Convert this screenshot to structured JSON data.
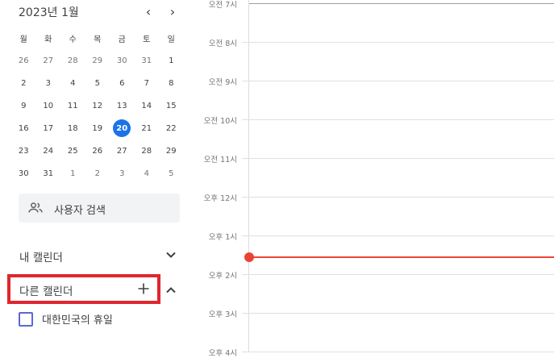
{
  "mini_calendar": {
    "title": "2023년 1월",
    "prev_icon": "‹",
    "next_icon": "›",
    "weekdays": [
      "월",
      "화",
      "수",
      "목",
      "금",
      "토",
      "일"
    ],
    "weeks": [
      [
        "26",
        "27",
        "28",
        "29",
        "30",
        "31",
        "1"
      ],
      [
        "2",
        "3",
        "4",
        "5",
        "6",
        "7",
        "8"
      ],
      [
        "9",
        "10",
        "11",
        "12",
        "13",
        "14",
        "15"
      ],
      [
        "16",
        "17",
        "18",
        "19",
        "20",
        "21",
        "22"
      ],
      [
        "23",
        "24",
        "25",
        "26",
        "27",
        "28",
        "29"
      ],
      [
        "30",
        "31",
        "1",
        "2",
        "3",
        "4",
        "5"
      ]
    ],
    "today": "20"
  },
  "search": {
    "label": "사용자 검색",
    "icon": "people-icon"
  },
  "my_calendars": {
    "title": "내 캘린더"
  },
  "other_calendars": {
    "title": "다른 캘린더",
    "items": [
      {
        "label": "대한민국의 휴일",
        "checked": false
      }
    ]
  },
  "timeline": {
    "hours": [
      "오전 7시",
      "오전 8시",
      "오전 9시",
      "오전 10시",
      "오전 11시",
      "오후 12시",
      "오후 1시",
      "오후 2시",
      "오후 3시",
      "오후 4시"
    ]
  },
  "colors": {
    "today_accent": "#1a73e8",
    "now_indicator": "#ea4335",
    "highlight_box": "#e0262e",
    "checkbox_border": "#5a6acf"
  }
}
